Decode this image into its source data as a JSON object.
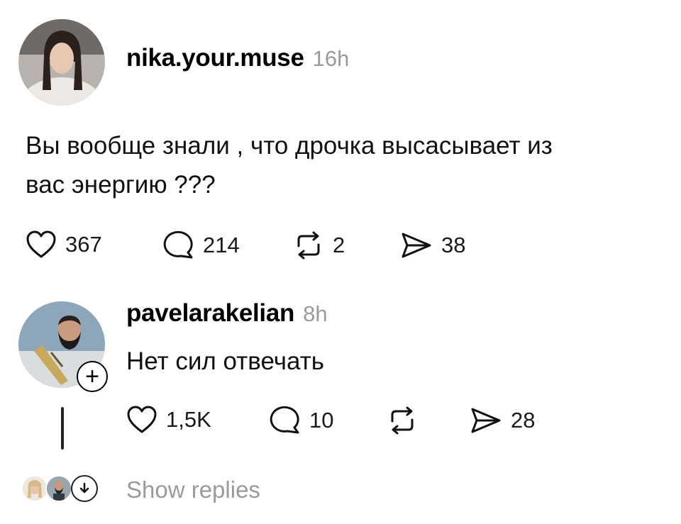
{
  "post": {
    "username": "nika.your.muse",
    "time": "16h",
    "text_line1": "Вы вообще знали , что дрочка высасывает из",
    "text_line2": "вас энергию ???",
    "likes": "367",
    "comments": "214",
    "reposts": "2",
    "shares": "38"
  },
  "reply": {
    "username": "pavelarakelian",
    "time": "8h",
    "text": "Нет сил отвечать",
    "likes": "1,5K",
    "comments": "10",
    "reposts": "",
    "shares": "28",
    "follow_badge": "+"
  },
  "show_replies": "Show replies",
  "icons": {
    "like": "heart-icon",
    "comment": "comment-bubble-icon",
    "repost": "repost-icon",
    "share": "send-icon",
    "show_replies": "chevron-down-icon"
  }
}
